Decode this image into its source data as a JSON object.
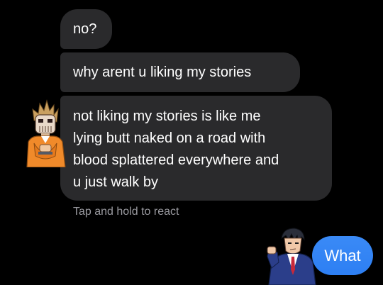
{
  "conversation": {
    "messages": [
      {
        "text": "no?"
      },
      {
        "text": "why arent u liking my stories"
      },
      {
        "lines": [
          "not liking my stories is like me",
          "lying butt naked on a road with",
          "blood splattered everywhere and",
          "u just walk by"
        ]
      }
    ],
    "react_hint": "Tap and hold to react",
    "my_reply": "What"
  },
  "colors": {
    "background": "#000000",
    "received_bubble": "#2a2a2c",
    "sent_bubble": "#3a8af6",
    "hint_text": "#9a9aa0"
  },
  "avatars": {
    "left": "masked-prisoner-sprite",
    "right": "suited-attorney-sprite"
  }
}
